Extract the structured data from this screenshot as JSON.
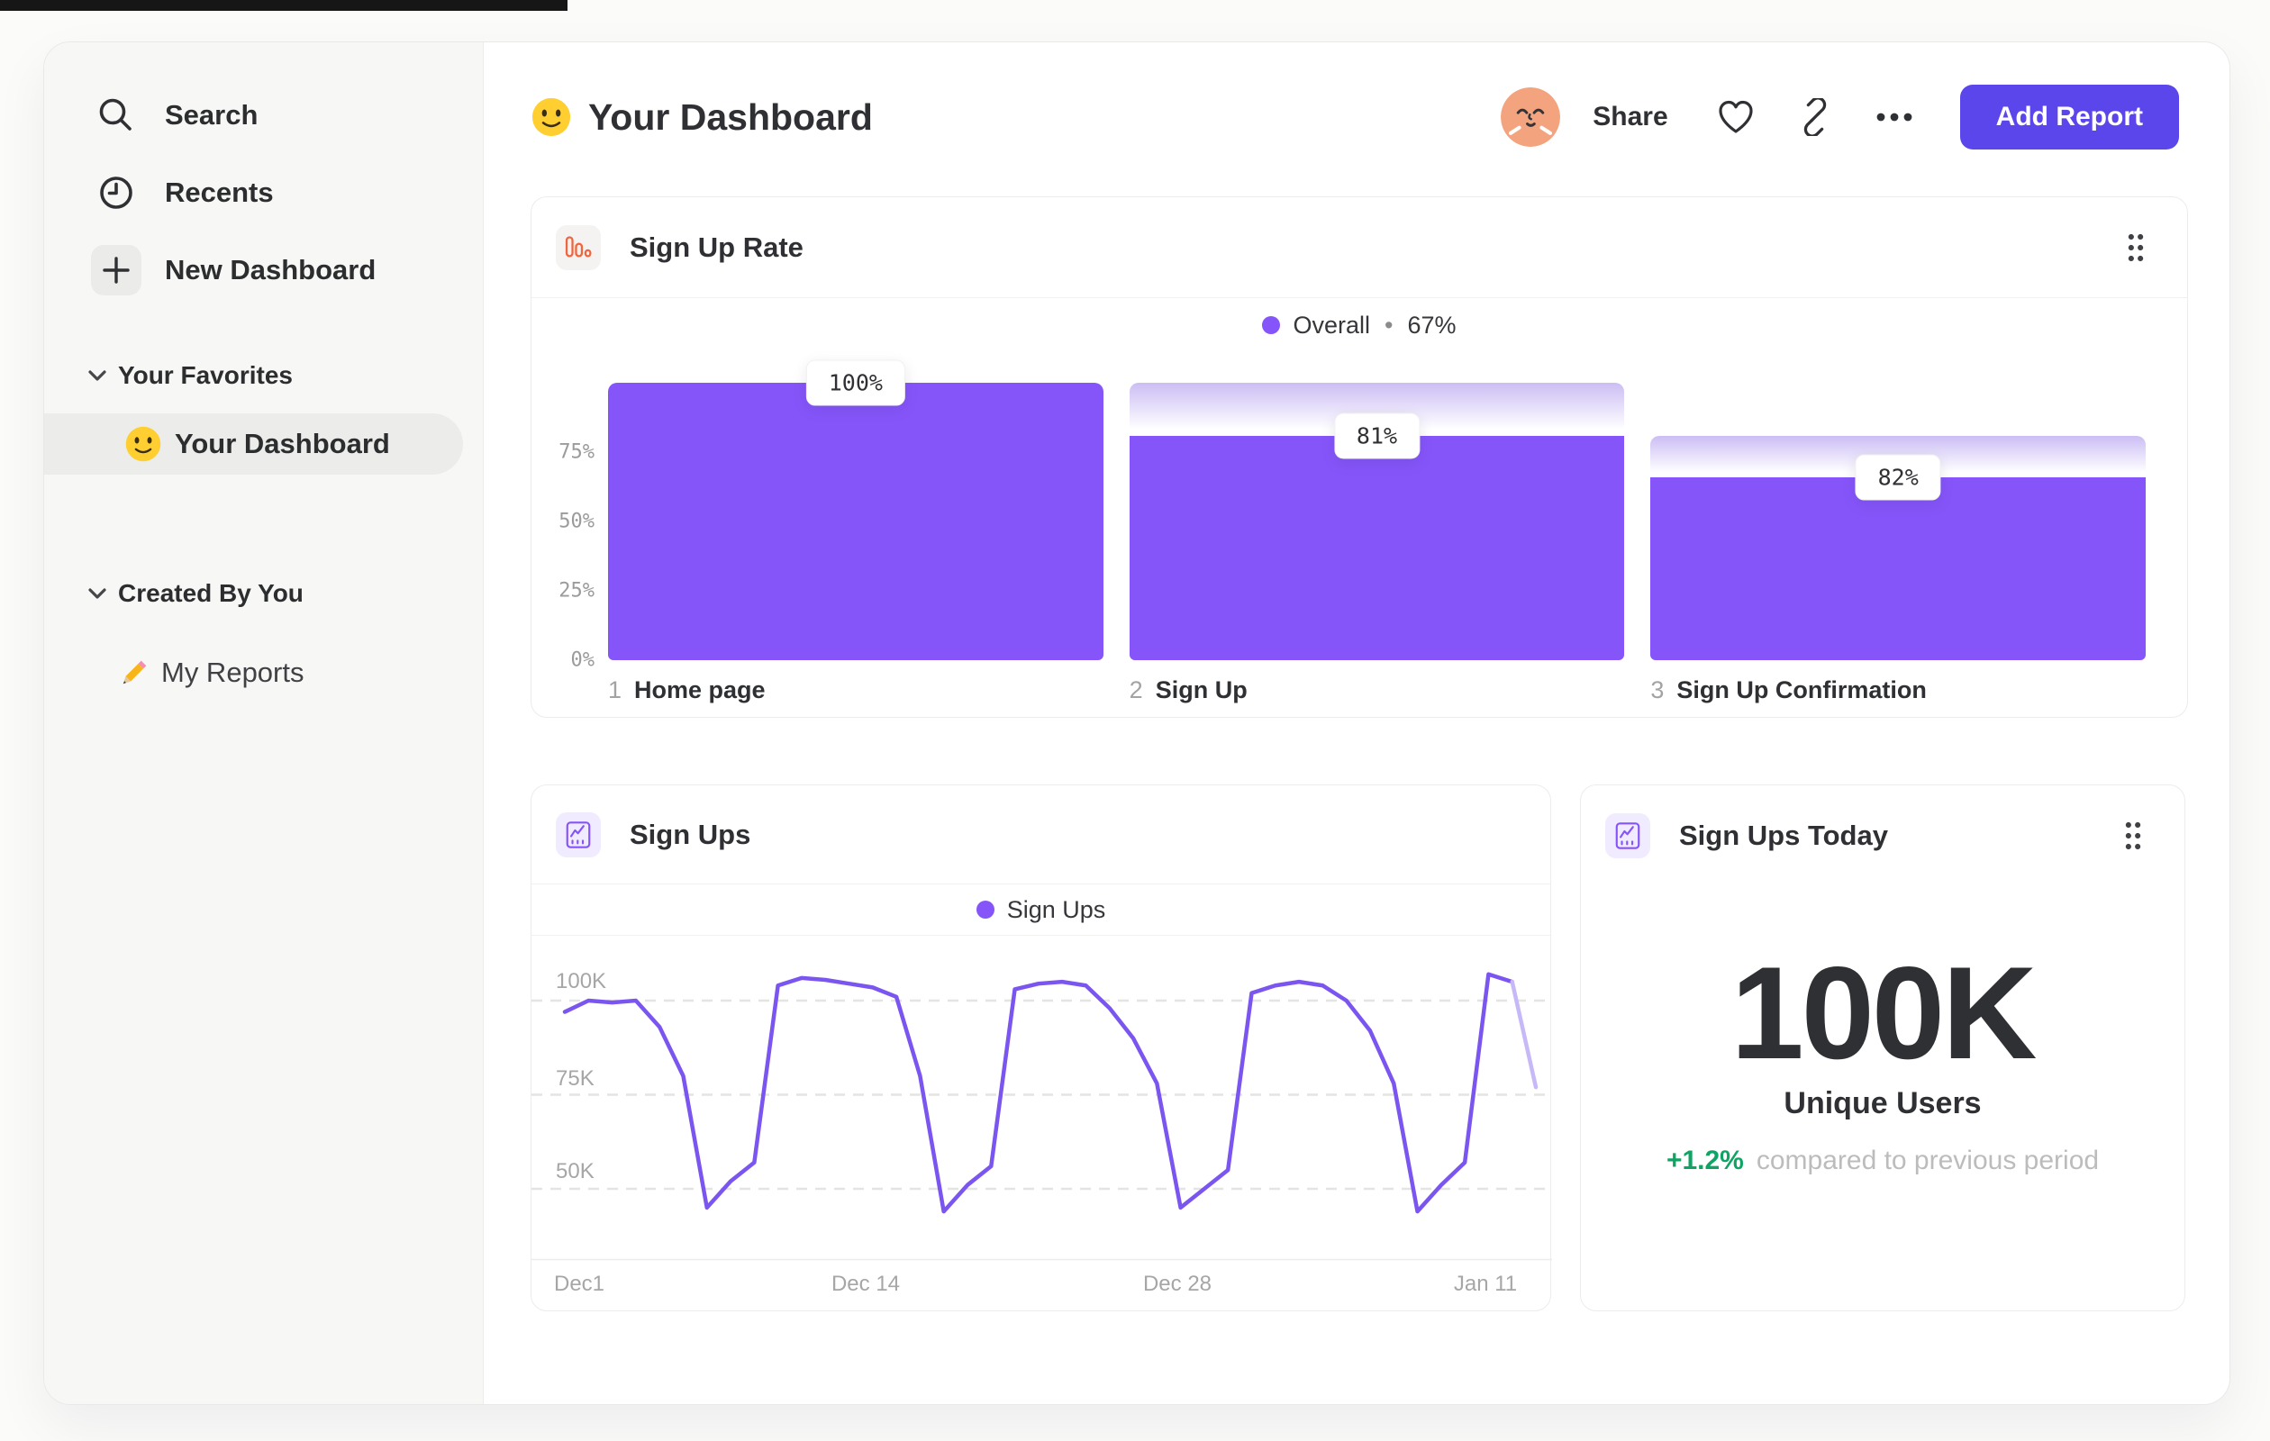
{
  "colors": {
    "accent_purple": "#8655FA",
    "line_purple": "#7B55F0",
    "faded_line_purple": "#C7B8F8",
    "button_purple": "#5B46EB",
    "icon_orange": "#F0653E",
    "delta_green": "#0FA463",
    "sidebar_bg": "#F7F7F5",
    "selected_pill_bg": "#ECECEA"
  },
  "sidebar": {
    "items": [
      {
        "icon": "search-icon",
        "label": "Search"
      },
      {
        "icon": "clock-icon",
        "label": "Recents"
      },
      {
        "icon": "plus-icon",
        "label": "New Dashboard"
      }
    ],
    "sections": [
      {
        "title": "Your Favorites",
        "items": [
          {
            "emoji": "slightly-smiling-face",
            "label": "Your Dashboard",
            "selected": true
          }
        ]
      },
      {
        "title": "Created By You",
        "items": [
          {
            "emoji": "pencil",
            "label": "My Reports",
            "selected": false
          }
        ]
      }
    ]
  },
  "header": {
    "emoji": "slightly-smiling-face",
    "title": "Your Dashboard",
    "share_label": "Share",
    "add_report_label": "Add Report"
  },
  "chart_data": [
    {
      "type": "bar",
      "chart_title": "Sign Up Rate",
      "legend": {
        "name": "Overall",
        "separator": "•",
        "value": "67%"
      },
      "y_tick_labels": [
        "75%",
        "50%",
        "25%",
        "0%"
      ],
      "ylim": [
        0,
        100
      ],
      "steps": [
        {
          "index": "1",
          "label": "Home page",
          "conversion_pct": 100,
          "overall_pct": 100,
          "tooltip": "100%"
        },
        {
          "index": "2",
          "label": "Sign Up",
          "conversion_pct": 81,
          "overall_pct": 81,
          "tooltip": "81%"
        },
        {
          "index": "3",
          "label": "Sign Up Confirmation",
          "conversion_pct": 82,
          "overall_pct": 66,
          "tooltip": "82%"
        }
      ]
    },
    {
      "type": "line",
      "chart_title": "Sign Ups",
      "x_tick_labels": [
        "Dec1",
        "Dec 14",
        "Dec 28",
        "Jan 11"
      ],
      "x_tick_days": [
        0,
        13,
        27,
        41
      ],
      "y_tick_labels": [
        "100K",
        "75K",
        "50K"
      ],
      "y_tick_values_k": [
        100,
        75,
        50
      ],
      "ylim_k": [
        30,
        112
      ],
      "grid": "dashed-horizontal",
      "legend_position": "top-center",
      "series": [
        {
          "name": "Sign Ups",
          "unit": "K",
          "values": [
            97,
            100,
            99.5,
            100,
            93,
            80,
            45,
            52,
            57,
            104,
            106,
            105.5,
            104.5,
            103.5,
            101,
            80,
            44,
            51,
            56,
            103,
            104.5,
            105,
            104,
            98,
            90,
            78,
            45,
            50,
            55,
            102,
            104,
            105,
            104,
            100,
            92,
            78,
            44,
            51,
            57,
            107,
            105,
            77
          ],
          "last_segment_faded": true
        }
      ]
    },
    {
      "type": "stat",
      "chart_title": "Sign Ups Today",
      "value": "100K",
      "value_label": "Unique Users",
      "delta": "+1.2%",
      "delta_direction": "up",
      "comparison_text": "compared to previous period"
    }
  ]
}
